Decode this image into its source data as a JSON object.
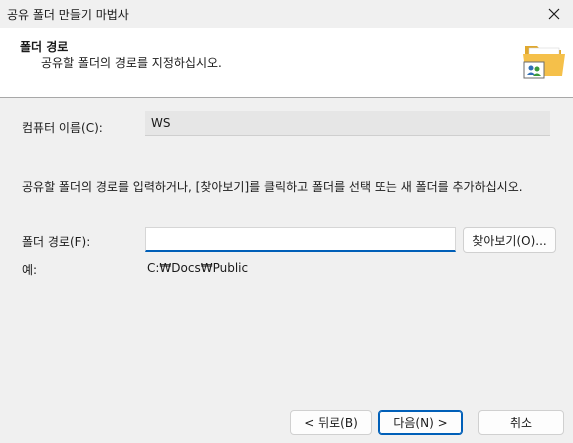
{
  "window": {
    "title": "공유 폴더 만들기 마법사"
  },
  "header": {
    "title": "폴더 경로",
    "subtitle": "공유할 폴더의 경로를 지정하십시오.",
    "icon": "shared-folder-icon"
  },
  "computer": {
    "label": "컴퓨터 이름(C):",
    "value": "WS"
  },
  "instruction": "공유할 폴더의 경로를 입력하거나, [찾아보기]를 클릭하고 폴더를 선택 또는 새 폴더를 추가하십시오.",
  "folder_path": {
    "label": "폴더 경로(F):",
    "value": "",
    "browse_label": "찾아보기(O)..."
  },
  "example": {
    "label": "예:",
    "value": "C:₩Docs₩Public"
  },
  "buttons": {
    "back": "< 뒤로(B)",
    "next": "다음(N) >",
    "cancel": "취소"
  },
  "colors": {
    "accent": "#005fb8",
    "folder": "#f5c04a"
  }
}
